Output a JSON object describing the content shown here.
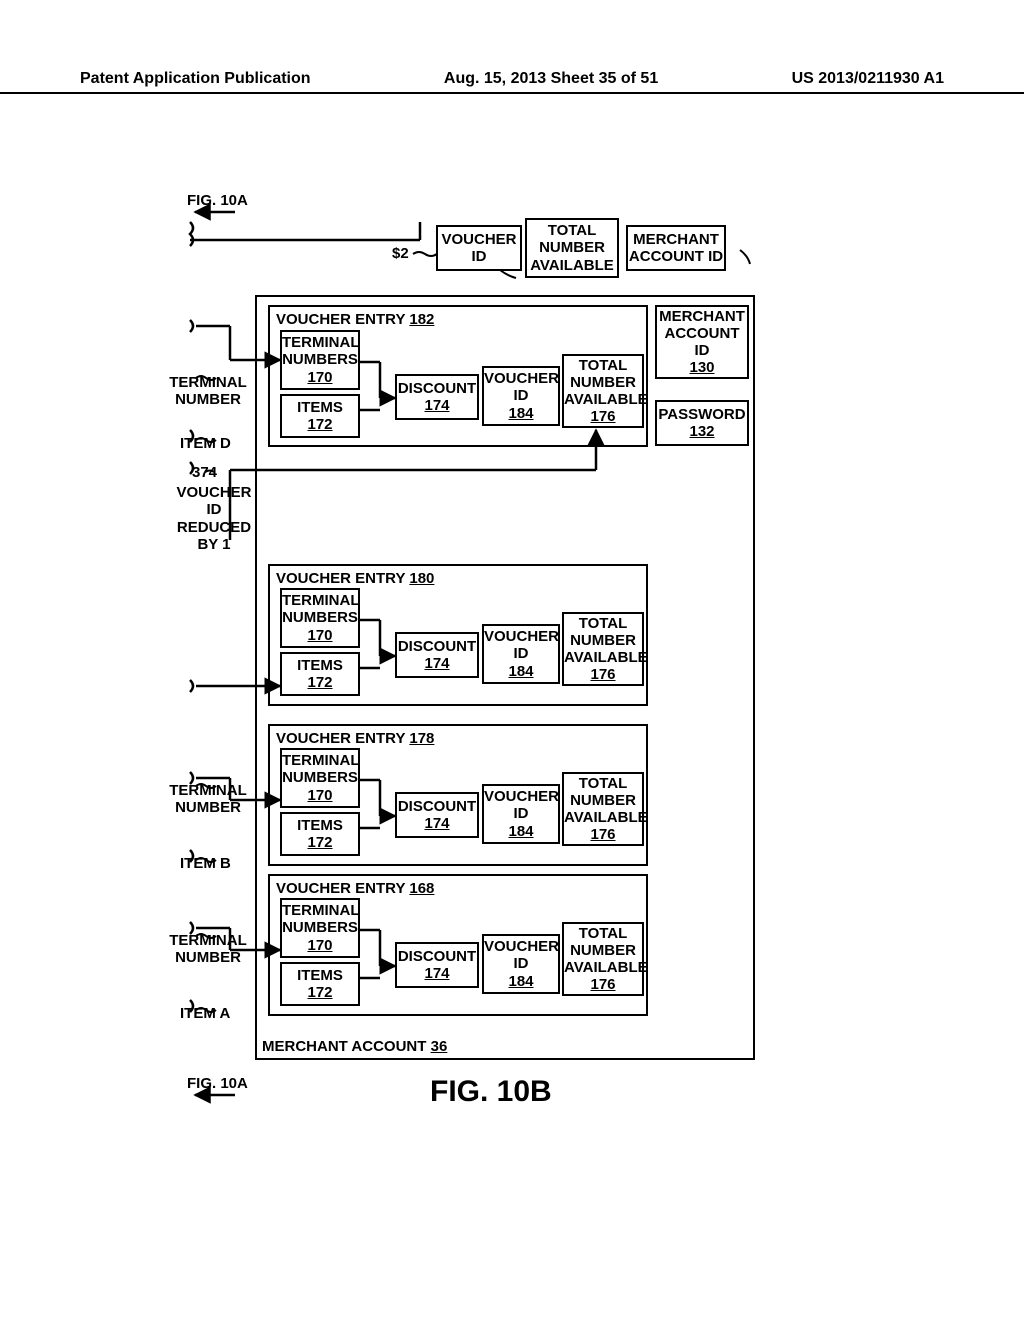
{
  "header": {
    "left": "Patent Application Publication",
    "mid": "Aug. 15, 2013  Sheet 35 of 51",
    "right": "US 2013/0211930 A1"
  },
  "figRefTop": "FIG. 10A",
  "figRefBottom": "FIG. 10A",
  "figTitle": "FIG. 10B",
  "topCallouts": {
    "price": "$2",
    "voucherId": "VOUCHER ID",
    "totalNumberAvailable": "TOTAL NUMBER AVAILABLE",
    "merchantAccountId": "MERCHANT ACCOUNT ID"
  },
  "merchantAccountId": {
    "label": "MERCHANT ACCOUNT ID",
    "num": "130"
  },
  "password": {
    "label": "PASSWORD",
    "num": "132"
  },
  "merchantAccount": {
    "label": "MERCHANT ACCOUNT",
    "num": "36"
  },
  "entries": {
    "e182": {
      "title": "VOUCHER ENTRY",
      "num": "182"
    },
    "e180": {
      "title": "VOUCHER ENTRY",
      "num": "180"
    },
    "e178": {
      "title": "VOUCHER ENTRY",
      "num": "178"
    },
    "e168": {
      "title": "VOUCHER ENTRY",
      "num": "168"
    }
  },
  "block": {
    "terminalNumbers": {
      "label": "TERMINAL NUMBERS",
      "num": "170"
    },
    "items": {
      "label": "ITEMS",
      "num": "172"
    },
    "discount": {
      "label": "DISCOUNT",
      "num": "174"
    },
    "voucherId": {
      "label": "VOUCHER ID",
      "num": "184"
    },
    "totalNumberAvailable": {
      "label": "TOTAL NUMBER AVAILABLE",
      "num": "176"
    }
  },
  "leftLabels": {
    "terminalNumber": "TERMINAL NUMBER",
    "itemD": "ITEM D",
    "ref374": "374",
    "voucherIdReduced": "VOUCHER ID REDUCED BY 1",
    "itemB": "ITEM B",
    "itemA": "ITEM A"
  }
}
